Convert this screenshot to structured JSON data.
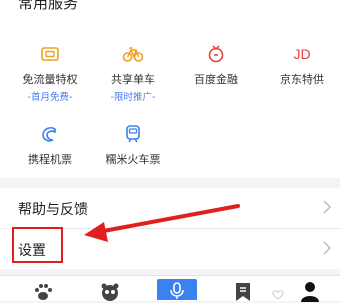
{
  "section_title": "常用服务",
  "services": [
    {
      "label": "免流量特权",
      "sub": "-首月免费-",
      "icon": "ticket-icon",
      "color": "#f0a020"
    },
    {
      "label": "共享单车",
      "sub": "-限时推广-",
      "icon": "bicycle-icon",
      "color": "#f0a020"
    },
    {
      "label": "百度金融",
      "sub": "",
      "icon": "finance-icon",
      "color": "#e8413b"
    },
    {
      "label": "京东特供",
      "sub": "",
      "icon": "jd-icon",
      "color": "#e8413b",
      "glyph": "JD"
    },
    {
      "label": "携程机票",
      "sub": "",
      "icon": "ctrip-icon",
      "color": "#3b82f0"
    },
    {
      "label": "糯米火车票",
      "sub": "",
      "icon": "train-icon",
      "color": "#3b82f0"
    }
  ],
  "menu": [
    {
      "label": "帮助与反馈"
    },
    {
      "label": "设置"
    }
  ],
  "tabbar": {
    "tabs": [
      "baidu-paw-icon",
      "community-icon",
      "microphone-icon",
      "bookmark-icon",
      "profile-icon"
    ],
    "accent": "#3b82f0"
  }
}
